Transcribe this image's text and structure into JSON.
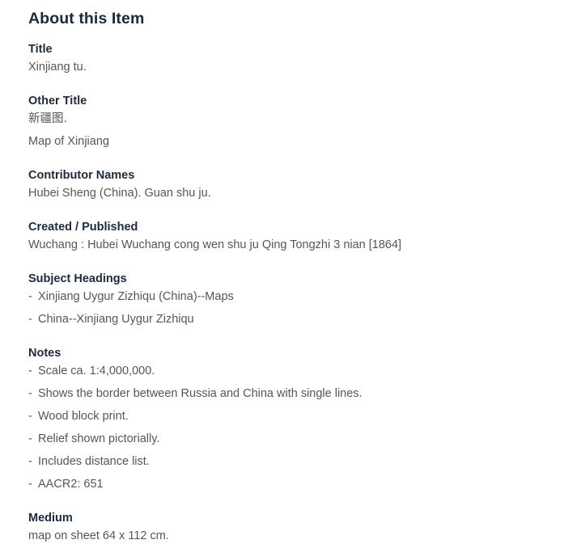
{
  "panel": {
    "title": "About this Item",
    "fields": [
      {
        "label": "Title",
        "style": "single",
        "values": [
          "Xinjiang tu."
        ]
      },
      {
        "label": "Other Title",
        "style": "plain-list",
        "values": [
          "新疆图.",
          "Map of Xinjiang"
        ]
      },
      {
        "label": "Contributor Names",
        "style": "single",
        "values": [
          "Hubei Sheng (China). Guan shu ju."
        ]
      },
      {
        "label": "Created / Published",
        "style": "single",
        "values": [
          "Wuchang : Hubei Wuchang cong wen shu ju Qing Tongzhi 3 nian [1864]"
        ]
      },
      {
        "label": "Subject Headings",
        "style": "dashed-list",
        "values": [
          "Xinjiang Uygur Zizhiqu (China)--Maps",
          "China--Xinjiang Uygur Zizhiqu"
        ]
      },
      {
        "label": "Notes",
        "style": "dashed-list",
        "values": [
          "Scale ca. 1:4,000,000.",
          "Shows the border between Russia and China with single lines.",
          "Wood block print.",
          "Relief shown pictorially.",
          "Includes distance list.",
          "AACR2: 651"
        ]
      },
      {
        "label": "Medium",
        "style": "single",
        "values": [
          "map on sheet 64 x 112 cm."
        ]
      }
    ],
    "dash_marker": "-"
  },
  "colors": {
    "heading": "#1c2a3a",
    "body": "#565656",
    "background": "#ffffff"
  }
}
